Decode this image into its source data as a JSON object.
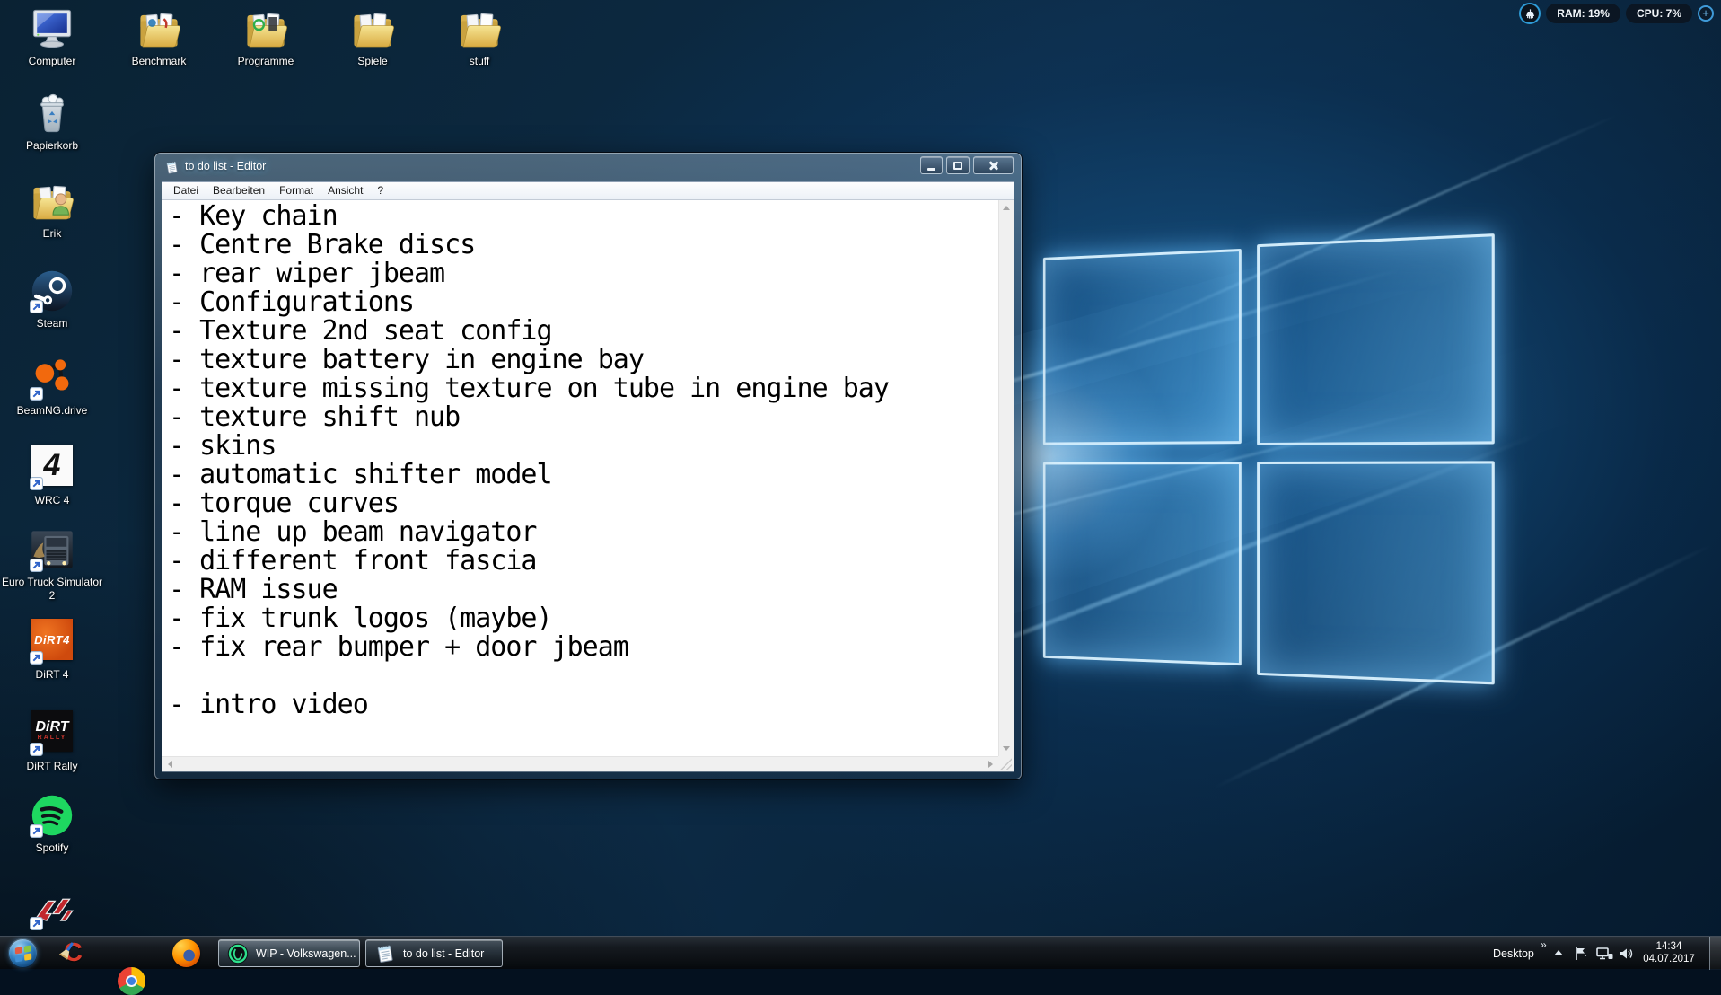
{
  "system_overlay": {
    "ram": "RAM: 19%",
    "cpu": "CPU: 7%",
    "add_label": "+"
  },
  "desktop": {
    "icons": [
      {
        "label": "Computer"
      },
      {
        "label": "Benchmark"
      },
      {
        "label": "Programme"
      },
      {
        "label": "Spiele"
      },
      {
        "label": "stuff"
      },
      {
        "label": "Papierkorb"
      },
      {
        "label": "Erik"
      },
      {
        "label": "Steam"
      },
      {
        "label": "BeamNG.drive"
      },
      {
        "label": "WRC 4"
      },
      {
        "label": "Euro Truck Simulator 2"
      },
      {
        "label": "DiRT 4"
      },
      {
        "label": "DiRT Rally"
      },
      {
        "label": "Spotify"
      },
      {
        "label": ""
      }
    ],
    "icon_text": {
      "wrc": "4",
      "dirt4": "DiRT4",
      "dirt_rally_top": "DiRT",
      "dirt_rally_bottom": "RALLY",
      "ccleaner": "C"
    }
  },
  "notepad": {
    "title": "to do list - Editor",
    "menu_items": [
      "Datei",
      "Bearbeiten",
      "Format",
      "Ansicht",
      "?"
    ],
    "lines": [
      "- Key chain",
      "- Centre Brake discs",
      "- rear wiper jbeam",
      "- Configurations",
      "- Texture 2nd seat config",
      "- texture battery in engine bay",
      "- texture missing texture on tube in engine bay",
      "- texture shift nub",
      "- skins",
      "- automatic shifter model",
      "- torque curves",
      "- line up beam navigator",
      "- different front fascia",
      "- RAM issue",
      "- fix trunk logos (maybe)",
      "- fix rear bumper + door jbeam",
      "",
      "- intro video"
    ]
  },
  "taskbar": {
    "buttons": [
      {
        "label": "WIP - Volkswagen..."
      },
      {
        "label": "to do list - Editor"
      }
    ],
    "tray": {
      "toolbar": "Desktop",
      "chevron": "»",
      "time": "14:34",
      "date": "04.07.2017"
    }
  },
  "colors": {
    "wallpaper_glow_blue": "#7fd4ff",
    "overlay_ring_blue": "#2e9bd6",
    "spotify_green": "#1ed760",
    "beamng_orange": "#f2690d",
    "dirt4_orange": "#e3541a",
    "ccleaner_red": "#d63a2a",
    "opera_green": "#2ee08c",
    "taskbar_black": "#0a0d11"
  }
}
